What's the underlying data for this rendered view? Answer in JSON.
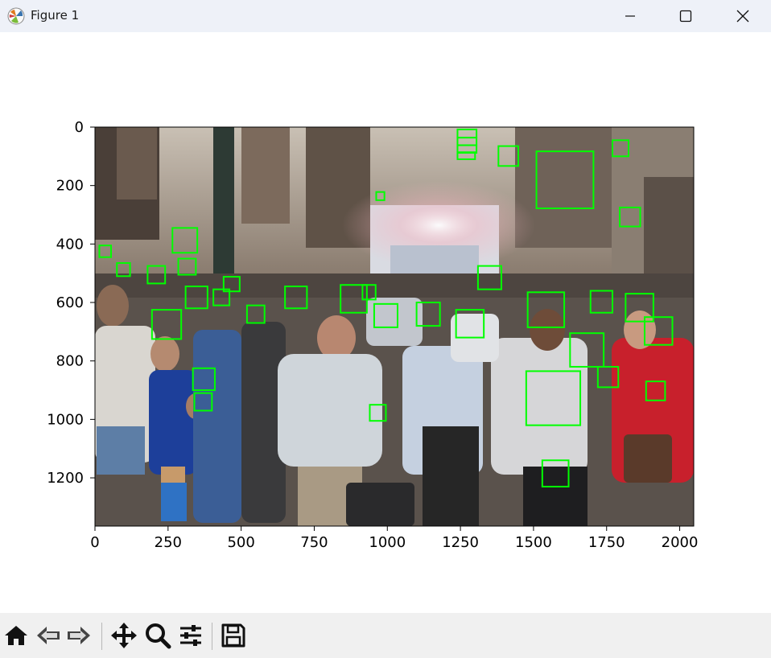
{
  "window": {
    "title": "Figure 1",
    "buttons": [
      "minimize",
      "maximize",
      "close"
    ]
  },
  "toolbar": {
    "buttons": [
      {
        "name": "home-button",
        "icon": "home-icon"
      },
      {
        "name": "back-button",
        "icon": "back-arrow-icon"
      },
      {
        "name": "forward-button",
        "icon": "forward-arrow-icon"
      },
      {
        "name": "pan-button",
        "icon": "move-icon"
      },
      {
        "name": "zoom-button",
        "icon": "magnifier-icon"
      },
      {
        "name": "configure-subplots-button",
        "icon": "sliders-icon"
      },
      {
        "name": "save-button",
        "icon": "floppy-disk-icon"
      }
    ]
  },
  "chart_data": {
    "type": "image",
    "description_type": "image with face detection boxes",
    "image_size": [
      2048,
      1365
    ],
    "xlim": [
      0,
      2048
    ],
    "ylim": [
      1365,
      0
    ],
    "xticks": [
      "0",
      "250",
      "500",
      "750",
      "1000",
      "1250",
      "1500",
      "1750",
      "2000"
    ],
    "yticks": [
      "0",
      "200",
      "400",
      "600",
      "800",
      "1000",
      "1200"
    ],
    "box_color": "#00ff00",
    "boxes": [
      [
        1240,
        8,
        65,
        28
      ],
      [
        1240,
        36,
        65,
        26
      ],
      [
        1240,
        62,
        65,
        26
      ],
      [
        1240,
        86,
        60,
        24
      ],
      [
        1380,
        65,
        68,
        68
      ],
      [
        1510,
        83,
        195,
        195
      ],
      [
        1770,
        45,
        55,
        55
      ],
      [
        962,
        222,
        28,
        28
      ],
      [
        1795,
        275,
        70,
        65
      ],
      [
        265,
        345,
        85,
        85
      ],
      [
        15,
        405,
        40,
        40
      ],
      [
        75,
        465,
        45,
        45
      ],
      [
        180,
        475,
        60,
        60
      ],
      [
        285,
        450,
        60,
        55
      ],
      [
        310,
        545,
        75,
        75
      ],
      [
        405,
        555,
        55,
        55
      ],
      [
        440,
        512,
        55,
        50
      ],
      [
        520,
        610,
        60,
        60
      ],
      [
        650,
        545,
        75,
        75
      ],
      [
        840,
        540,
        90,
        95
      ],
      [
        915,
        540,
        45,
        50
      ],
      [
        955,
        605,
        80,
        80
      ],
      [
        1100,
        600,
        80,
        80
      ],
      [
        1235,
        625,
        95,
        95
      ],
      [
        1310,
        475,
        80,
        80
      ],
      [
        1480,
        565,
        125,
        120
      ],
      [
        1625,
        705,
        115,
        115
      ],
      [
        1695,
        560,
        75,
        75
      ],
      [
        1815,
        570,
        95,
        95
      ],
      [
        1880,
        650,
        95,
        95
      ],
      [
        1720,
        820,
        70,
        70
      ],
      [
        1885,
        870,
        65,
        65
      ],
      [
        195,
        625,
        100,
        100
      ],
      [
        335,
        825,
        75,
        75
      ],
      [
        340,
        910,
        60,
        60
      ],
      [
        940,
        950,
        55,
        55
      ],
      [
        1475,
        835,
        185,
        185
      ],
      [
        1530,
        1140,
        90,
        90
      ]
    ]
  }
}
